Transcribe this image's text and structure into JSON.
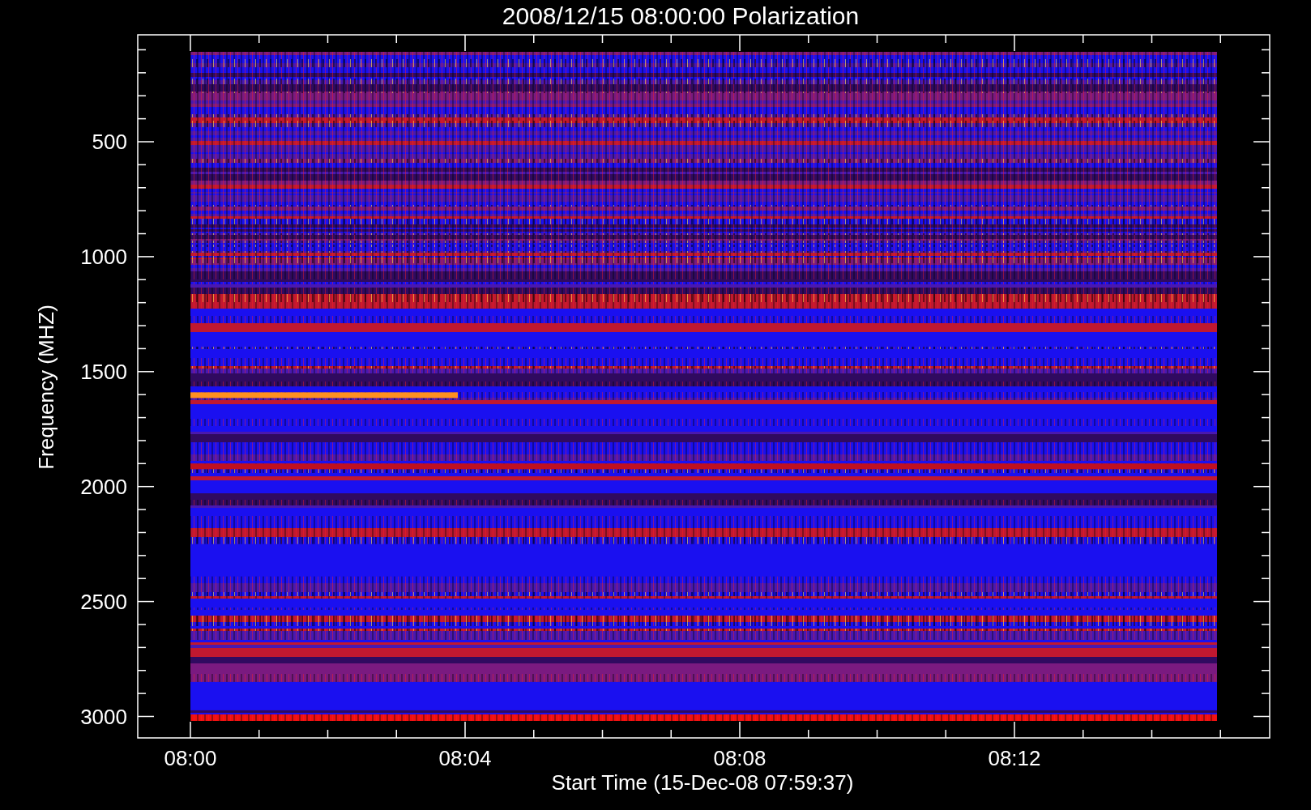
{
  "title": "2008/12/15 08:00:00 Polarization",
  "y_axis": {
    "label": "Frequency (MHZ)",
    "ticks": [
      "500",
      "1000",
      "1500",
      "2000",
      "2500",
      "3000"
    ]
  },
  "x_axis": {
    "label": "Start Time (15-Dec-08 07:59:37)",
    "ticks": [
      "08:00",
      "08:04",
      "08:08",
      "08:12"
    ]
  }
}
